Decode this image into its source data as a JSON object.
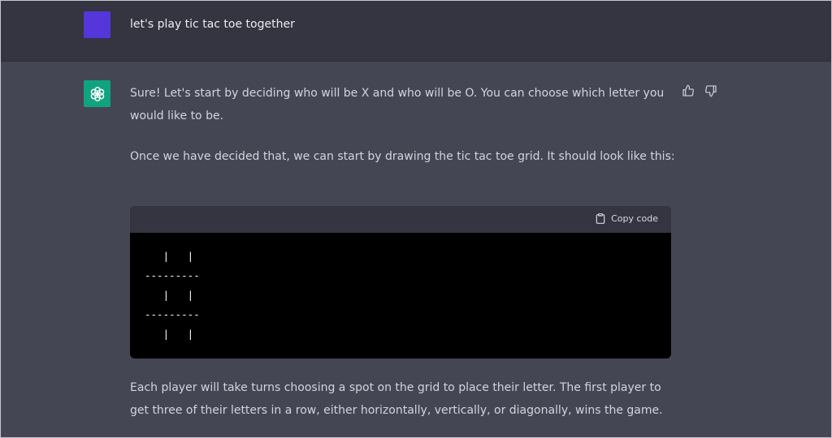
{
  "user_message": {
    "text": "let's play tic tac toe together"
  },
  "assistant_message": {
    "paragraph_1": "Sure! Let's start by deciding who will be X and who will be O. You can choose which letter you would like to be.",
    "paragraph_2": "Once we have decided that, we can start by drawing the tic tac toe grid. It should look like this:",
    "paragraph_3": "Each player will take turns choosing a spot on the grid to place their letter. The first player to get three of their letters in a row, either horizontally, vertically, or diagonally, wins the game.",
    "code_block": {
      "copy_label": "Copy code",
      "content": "   |   |\n---------\n   |   |\n---------\n   |   |"
    },
    "icons": {
      "avatar": "openai-logo-icon",
      "thumbs_up": "thumbs-up-icon",
      "thumbs_down": "thumbs-down-icon",
      "copy": "clipboard-icon"
    }
  },
  "colors": {
    "user_row_bg": "#343541",
    "assistant_row_bg": "#444654",
    "user_avatar": "#5436da",
    "assistant_avatar": "#10a37f",
    "code_bg": "#000000",
    "code_header_bg": "#343541"
  }
}
